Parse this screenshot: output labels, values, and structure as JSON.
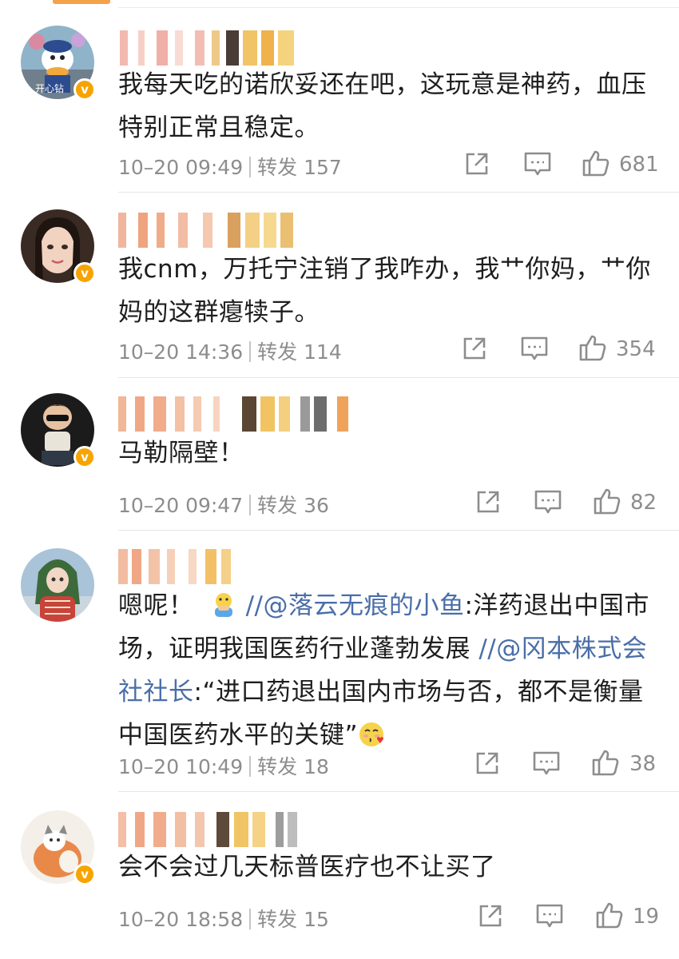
{
  "comments": [
    {
      "avatar_label": "开心钻",
      "text": "我每天吃的诺欣妥还在吧，这玩意是神药，血压特别正常且稳定。",
      "time": "10–20 09:49",
      "repost_label": "转发",
      "repost_count": "157",
      "likes": "681"
    },
    {
      "text": "我cnm，万托宁注销了我咋办，我艹你妈，艹你妈的这群瘪犊子。",
      "time": "10–20 14:36",
      "repost_label": "转发",
      "repost_count": "114",
      "likes": "354"
    },
    {
      "text": "马勒隔壁！",
      "time": "10–20 09:47",
      "repost_label": "转发",
      "repost_count": "36",
      "likes": "82"
    },
    {
      "text_prefix": "嗯呢！",
      "link1": "//@落云无痕的小鱼",
      "text_mid": ":洋药退出中国市场，证明我国医药行业蓬勃发展",
      "link2": "//@冈本株式会社社长",
      "text_end": ":“进口药退出国内市场与否，都不是衡量中国医药水平的关键”",
      "time": "10–20 10:49",
      "repost_label": "转发",
      "repost_count": "18",
      "likes": "38"
    },
    {
      "text": "会不会过几天标普医疗也不让买了",
      "time": "10–20 18:58",
      "repost_label": "转发",
      "repost_count": "15",
      "likes": "19"
    }
  ],
  "icons": {
    "verified": "verified-badge-icon",
    "share": "share-icon",
    "comment": "comment-icon",
    "like": "thumbs-up-icon"
  },
  "colors": {
    "link": "#4a6ea8",
    "verified": "#f7a400",
    "meta": "#8d8d8d"
  }
}
